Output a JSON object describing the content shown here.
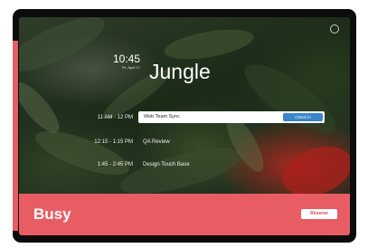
{
  "clock": {
    "time": "10:45",
    "date": "Fri, April 17"
  },
  "room": {
    "name": "Jungle"
  },
  "agenda": [
    {
      "time": "11 AM - 12 PM",
      "title": "Web Team Sync",
      "is_current": true
    },
    {
      "time": "12:15 - 1:15 PM",
      "title": "QA Review",
      "is_current": false
    },
    {
      "time": "1:45 - 2:45 PM",
      "title": "Design Touch Base",
      "is_current": false
    }
  ],
  "current_meeting": {
    "title": "Web Team Sync",
    "check_in_label": "Check in"
  },
  "status": {
    "label": "Busy",
    "reserve_label": "Reserve"
  },
  "colors": {
    "busy_red": "#e85d64",
    "check_in_blue": "#3a86c8",
    "device_bezel": "#0b0c0b"
  },
  "icons": {
    "settings": "gear-icon"
  }
}
